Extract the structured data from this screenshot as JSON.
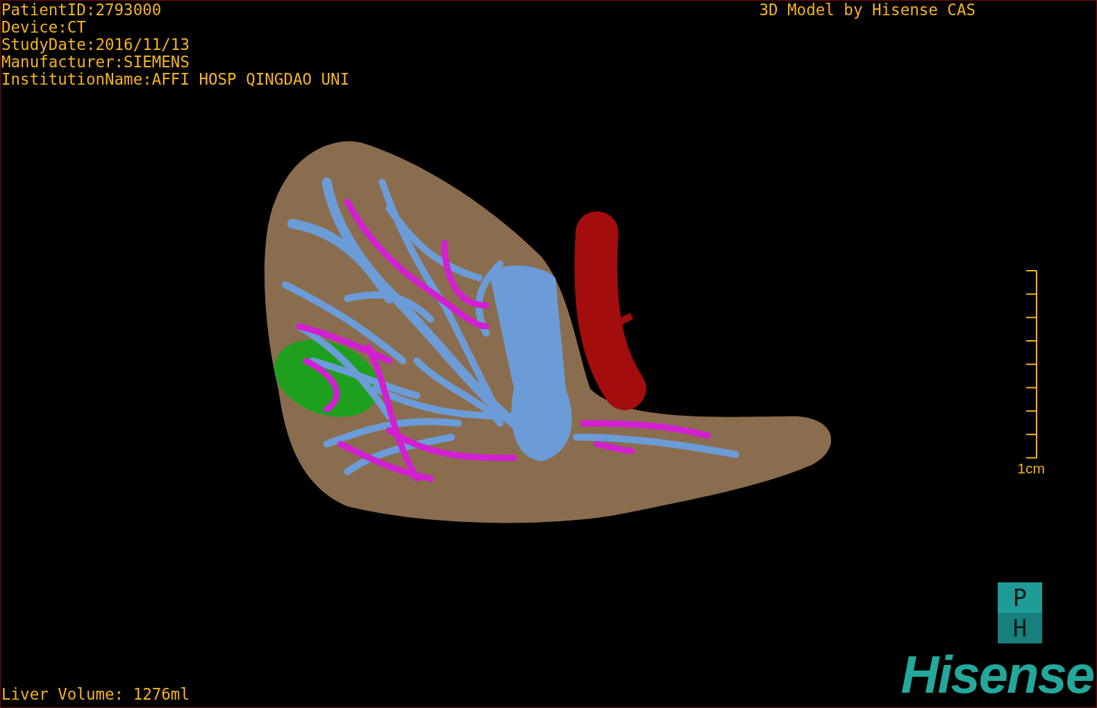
{
  "patient_info": [
    "PatientID:2793000",
    "Device:CT",
    "StudyDate:2016/11/13",
    "Manufacturer:SIEMENS",
    "InstitutionName:AFFI HOSP QINGDAO UNI"
  ],
  "title": "3D Model by Hisense CAS",
  "render": {
    "kind": "liver-model"
  },
  "scale_bar": {
    "label": "1cm"
  },
  "orientation_marker": {
    "top": "P",
    "bottom": "H"
  },
  "liver_volume": "Liver Volume: 1276ml",
  "logo": "Hisense"
}
